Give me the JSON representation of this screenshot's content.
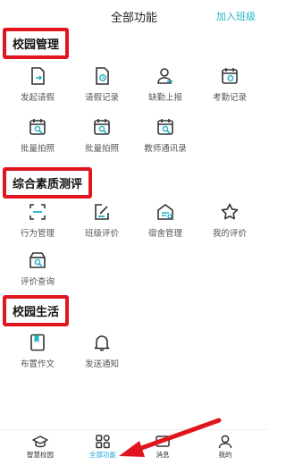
{
  "header": {
    "title": "全部功能",
    "join_class": "加入班级"
  },
  "sections": [
    {
      "name": "校园管理",
      "items": [
        {
          "label": "发起请假",
          "icon": "leave-request-icon"
        },
        {
          "label": "请假记录",
          "icon": "leave-record-icon"
        },
        {
          "label": "缺勤上报",
          "icon": "absence-report-icon"
        },
        {
          "label": "考勤记录",
          "icon": "attendance-record-icon"
        },
        {
          "label": "批量拍照",
          "icon": "batch-photo-icon"
        },
        {
          "label": "批量拍照",
          "icon": "batch-photo-icon"
        },
        {
          "label": "教师通讯录",
          "icon": "teacher-contacts-icon"
        }
      ]
    },
    {
      "name": "综合素质测评",
      "items": [
        {
          "label": "行为管理",
          "icon": "behavior-scan-icon"
        },
        {
          "label": "班级评价",
          "icon": "class-evaluation-icon"
        },
        {
          "label": "宿舍管理",
          "icon": "dormitory-icon"
        },
        {
          "label": "我的评价",
          "icon": "star-icon"
        },
        {
          "label": "评价查询",
          "icon": "evaluation-query-icon"
        }
      ]
    },
    {
      "name": "校园生活",
      "items": [
        {
          "label": "布置作文",
          "icon": "book-icon"
        },
        {
          "label": "发送通知",
          "icon": "bell-icon"
        }
      ]
    }
  ],
  "tabbar": [
    {
      "label": "智慧校园",
      "icon": "graduation-cap-icon",
      "active": false
    },
    {
      "label": "全部功能",
      "icon": "grid-icon",
      "active": true
    },
    {
      "label": "消息",
      "icon": "message-icon",
      "active": false
    },
    {
      "label": "我的",
      "icon": "user-icon",
      "active": false
    }
  ],
  "colors": {
    "accent": "#1fb3c4",
    "icon": "#333333",
    "highlight": "#e0161f",
    "active_tab": "#1ea2d4"
  }
}
